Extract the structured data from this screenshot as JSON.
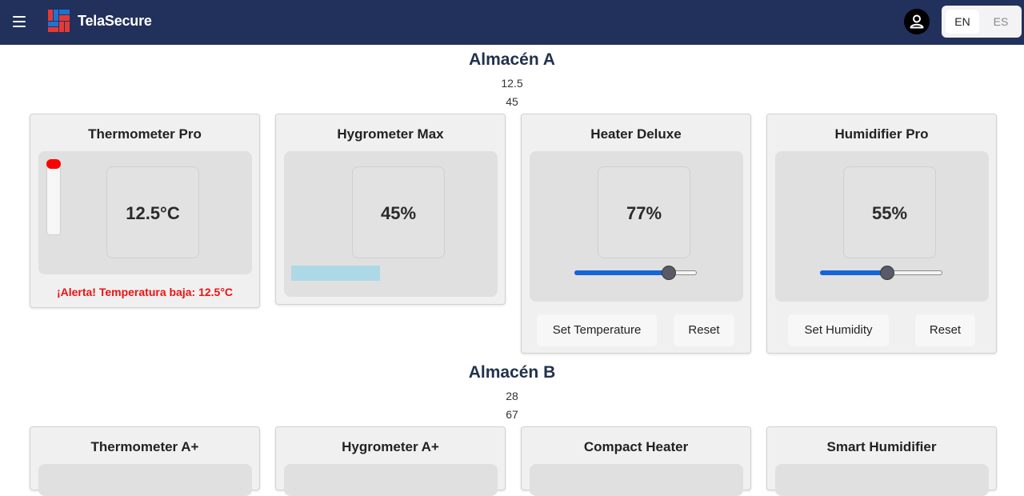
{
  "header": {
    "brand": "TelaSecure",
    "lang_en": "EN",
    "lang_es": "ES",
    "colors": {
      "bar": "#22305c",
      "logo_red": "#e53935",
      "logo_blue": "#1e73d2"
    }
  },
  "sections": [
    {
      "title": "Almacén A",
      "temperature": "12.5",
      "humidity": "45",
      "cards": {
        "thermometer": {
          "title": "Thermometer Pro",
          "value": "12.5°C",
          "alert": "¡Alerta! Temperatura baja: 12.5°C",
          "level": 0.04
        },
        "hygrometer": {
          "title": "Hygrometer Max",
          "value": "45%",
          "level": 0.45
        },
        "heater": {
          "title": "Heater Deluxe",
          "value": "77%",
          "slider": 77,
          "set_label": "Set Temperature",
          "reset_label": "Reset"
        },
        "humidifier": {
          "title": "Humidifier Pro",
          "value": "55%",
          "slider": 55,
          "set_label": "Set Humidity",
          "reset_label": "Reset"
        }
      }
    },
    {
      "title": "Almacén B",
      "temperature": "28",
      "humidity": "67",
      "cards": {
        "thermometer": {
          "title": "Thermometer A+"
        },
        "hygrometer": {
          "title": "Hygrometer A+"
        },
        "heater": {
          "title": "Compact Heater"
        },
        "humidifier": {
          "title": "Smart Humidifier"
        }
      }
    }
  ],
  "colors": {
    "alert": "#ee1111",
    "slider_fill": "#1565d8",
    "hygrometer_bar": "#add8e6",
    "thermo_fill": "#ff0000"
  }
}
